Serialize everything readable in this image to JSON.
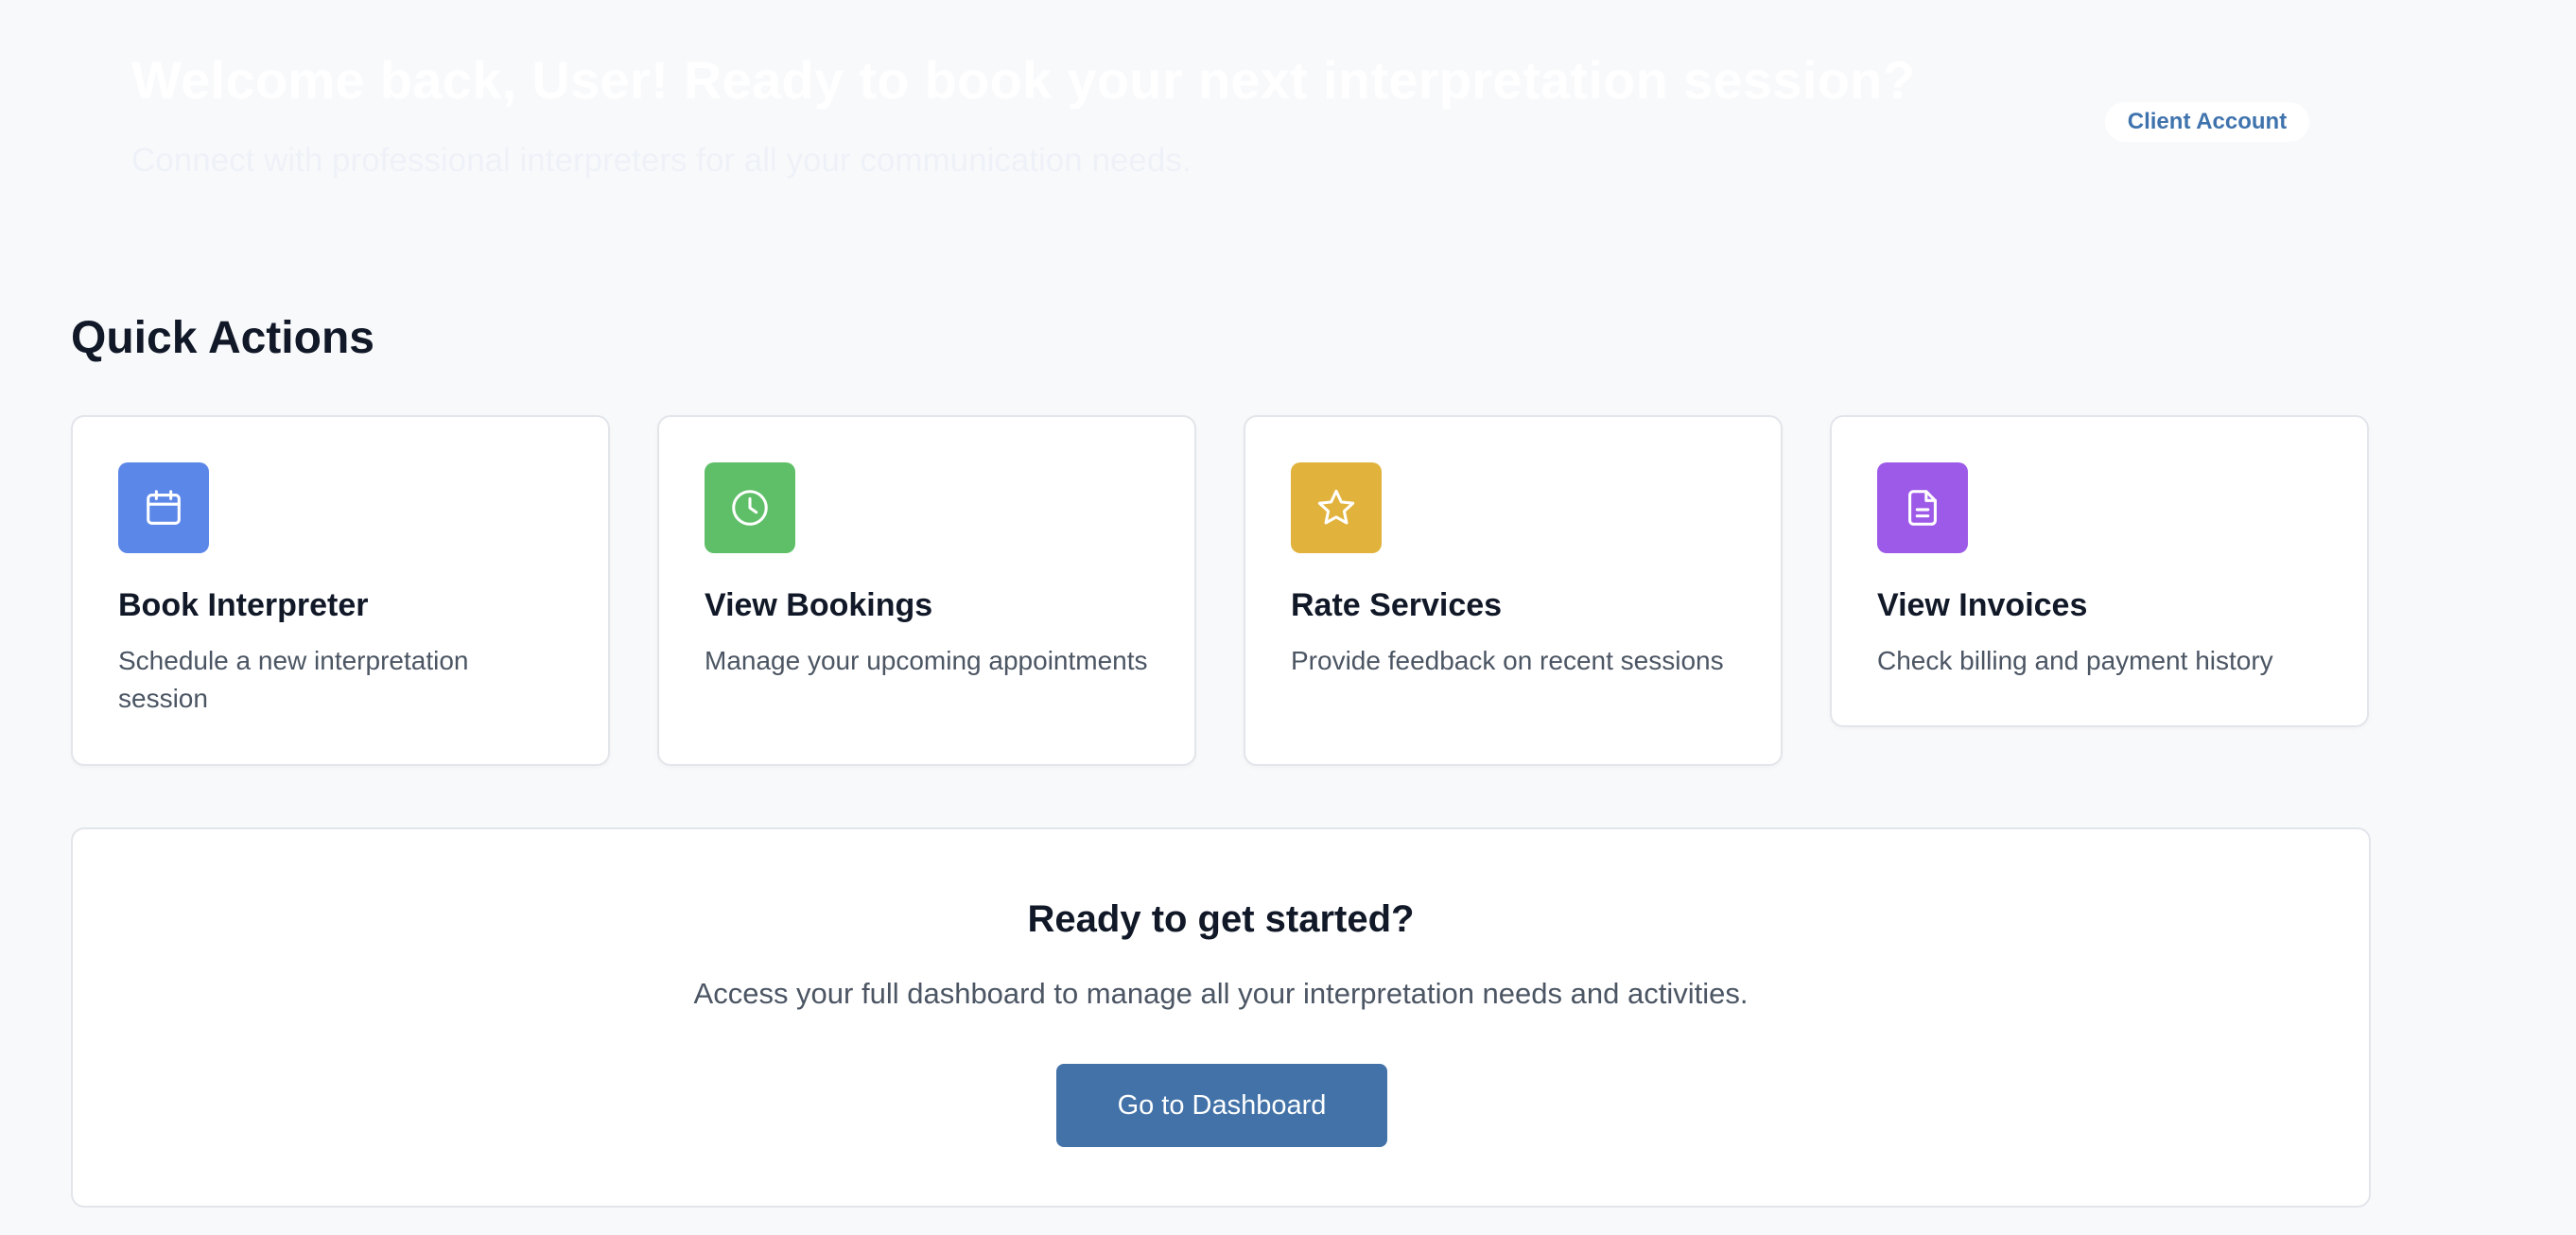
{
  "hero": {
    "title": "Welcome back, User! Ready to book your next interpretation session?",
    "subtitle": "Connect with professional interpreters for all your communication needs.",
    "account_badge": "Client Account"
  },
  "quick_actions": {
    "heading": "Quick Actions",
    "cards": [
      {
        "title": "Book Interpreter",
        "description": "Schedule a new interpretation session",
        "icon": "calendar-icon",
        "color": "#5b87e8"
      },
      {
        "title": "View Bookings",
        "description": "Manage your upcoming appointments",
        "icon": "clock-icon",
        "color": "#5fbf68"
      },
      {
        "title": "Rate Services",
        "description": "Provide feedback on recent sessions",
        "icon": "star-icon",
        "color": "#e1b33c"
      },
      {
        "title": "View Invoices",
        "description": "Check billing and payment history",
        "icon": "document-icon",
        "color": "#9d5ae8"
      }
    ]
  },
  "cta": {
    "title": "Ready to get started?",
    "text": "Access your full dashboard to manage all your interpretation needs and activities.",
    "button_label": "Go to Dashboard"
  }
}
